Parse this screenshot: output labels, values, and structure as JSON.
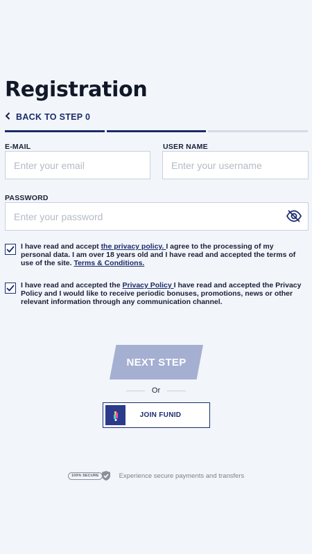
{
  "page": {
    "title": "Registration",
    "back_label": "BACK TO STEP 0"
  },
  "progress": {
    "completed_steps": 2,
    "total_steps": 3
  },
  "form": {
    "email": {
      "label": "E-MAIL",
      "placeholder": "Enter your email"
    },
    "username": {
      "label": "USER NAME",
      "placeholder": "Enter your username"
    },
    "password": {
      "label": "PASSWORD",
      "placeholder": "Enter your password"
    }
  },
  "consents": [
    {
      "checked": true,
      "text_before": "I have read and accept ",
      "link1": "the privacy policy. ",
      "text_middle": " I agree to the processing of my personal data. I am over 18 years old and I have read and accepted the terms of use of the site. ",
      "link2": "Terms & Conditions."
    },
    {
      "checked": true,
      "text_before": "I have read and accepted the ",
      "link1": "Privacy Policy ",
      "text_after": " I have read and accepted the Privacy Policy and I would like to receive periodic bonuses, promotions, news or other relevant information through any communication channel."
    }
  ],
  "actions": {
    "next_label": "NEXT STEP",
    "or_label": "Or",
    "funid_label": "JOIN FUNID"
  },
  "footer": {
    "badge_text": "100% SECURE",
    "message": "Experience secure payments and transfers"
  },
  "colors": {
    "primary": "#1a2b6b",
    "next_button": "#a4afd2",
    "background": "#f2f6fb"
  }
}
